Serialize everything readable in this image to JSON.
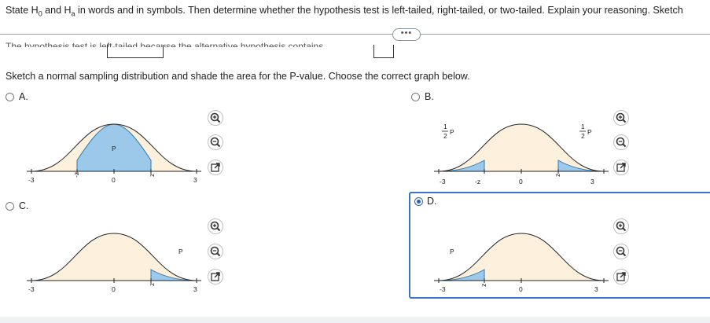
{
  "question": {
    "prefix": "State H",
    "sub0": "0",
    "mid": " and H",
    "suba": "a",
    "rest": " in words and in symbols. Then determine whether the hypothesis test is left-tailed, right-tailed, or two-tailed. Explain your reasoning. Sketch"
  },
  "expand_button": "•••",
  "cut_line": "The hypothesis test is        left-tailed        because the alternative hypothesis contains",
  "instruction": "Sketch a normal sampling distribution and shade the area for the P-value. Choose the correct graph below.",
  "options": [
    {
      "letter": "A.",
      "selected": false,
      "labels": {
        "left_tick": "-3",
        "z_left": "-z",
        "center": "0",
        "z_right": "z",
        "right_tick": "3",
        "p": "P"
      }
    },
    {
      "letter": "B.",
      "selected": false,
      "labels": {
        "left_tick": "-3",
        "z_left": "-z",
        "center": "0",
        "z_right": "z",
        "right_tick": "3",
        "p_num": "1",
        "p_den": "2",
        "p": "P"
      }
    },
    {
      "letter": "C.",
      "selected": false,
      "labels": {
        "left_tick": "-3",
        "center": "0",
        "z_right": "z",
        "right_tick": "3",
        "p": "P"
      }
    },
    {
      "letter": "D.",
      "selected": true,
      "labels": {
        "left_tick": "-3",
        "z_right": "z",
        "center": "0",
        "right_tick": "3",
        "p": "P"
      }
    }
  ],
  "tools": [
    "zoom-in-icon",
    "zoom-out-icon",
    "popout-icon"
  ],
  "colors": {
    "curve_fill": "#fdf0dc",
    "shade": "#9cc8ea",
    "shade_stroke": "#2e7db8",
    "selected_border": "#3b73c4",
    "radio": "#2b62b8"
  }
}
